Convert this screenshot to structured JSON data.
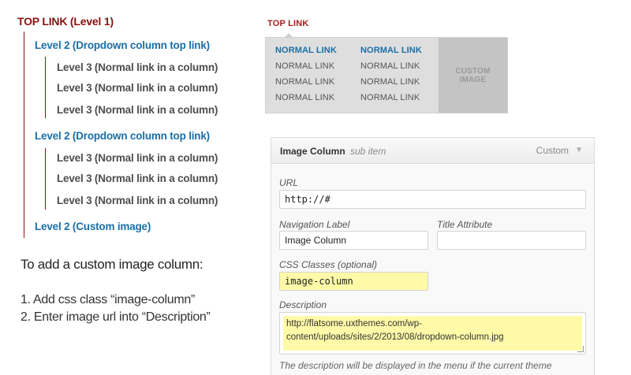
{
  "tree": {
    "level1": "TOP LINK (Level 1)",
    "group1": {
      "level2": "Level 2 (Dropdown column top link)",
      "level3": [
        "Level 3 (Normal link in a column)",
        "Level 3 (Normal link in a column)",
        "Level 3 (Normal link in a column)"
      ]
    },
    "group2": {
      "level2": "Level 2 (Dropdown column top link)",
      "level3": [
        "Level 3 (Normal link in a column)",
        "Level 3 (Normal link in a column)",
        "Level 3 (Normal link in a column)"
      ]
    },
    "level2_custom": "Level 2 (Custom image)",
    "howto_title": "To add a custom image column:",
    "steps": [
      "1. Add css class “image-column”",
      "2. Enter image url into “Description”"
    ]
  },
  "preview": {
    "top_link": "TOP LINK",
    "col1": [
      "NORMAL LINK",
      "NORMAL LINK",
      "NORMAL LINK",
      "NORMAL LINK"
    ],
    "col2": [
      "NORMAL LINK",
      "NORMAL LINK",
      "NORMAL LINK",
      "NORMAL LINK"
    ],
    "custom_image_line1": "CUSTOM",
    "custom_image_line2": "IMAGE"
  },
  "panel": {
    "title": "Image Column",
    "subtitle": "sub item",
    "type": "Custom",
    "arrow": "▼",
    "url_label": "URL",
    "url_value": "http://#",
    "nav_label_label": "Navigation Label",
    "nav_label_value": "Image Column",
    "title_attr_label": "Title Attribute",
    "title_attr_value": "",
    "css_label": "CSS Classes (optional)",
    "css_value": "image-column",
    "desc_label": "Description",
    "desc_line1": "http://flatsome.uxthemes.com/wp-",
    "desc_line2": "content/uploads/sites/2/2013/08/dropdown-column.jpg",
    "desc_note": "The description will be displayed in the menu if the current theme"
  }
}
